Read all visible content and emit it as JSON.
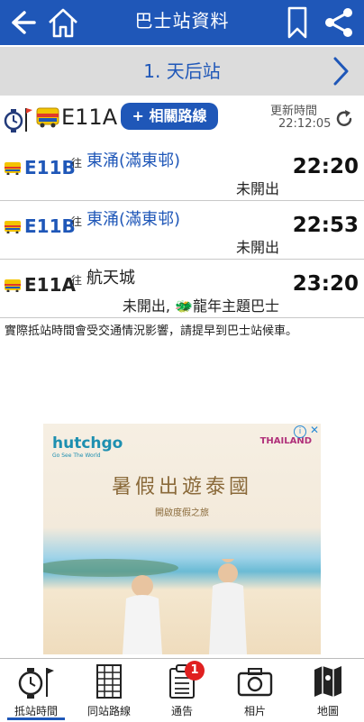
{
  "header": {
    "title": "巴士站資料"
  },
  "stop": {
    "name": "1. 天后站"
  },
  "route": {
    "number": "E11A",
    "related_button": "+ 相關路線",
    "updated_label": "更新時間",
    "updated_time": "22:12:05"
  },
  "etas": [
    {
      "route": "E11B",
      "direction": "往",
      "destination": "東涌(滿東邨)",
      "status": "未開出",
      "time": "22:20",
      "route_color": "#1f57b8",
      "dest_color": "#1f57b8"
    },
    {
      "route": "E11B",
      "direction": "往",
      "destination": "東涌(滿東邨)",
      "status": "未開出",
      "time": "22:53",
      "route_color": "#1f57b8",
      "dest_color": "#1f57b8"
    },
    {
      "route": "E11A",
      "direction": "往",
      "destination": "航天城",
      "status": "未開出, 🐲龍年主題巴士",
      "time": "23:20",
      "route_color": "#111111",
      "dest_color": "#111111"
    }
  ],
  "notice": "實際抵站時間會受交通情況影響，請提早到巴士站候車。",
  "ad": {
    "brand": "hutchgo",
    "brand_tagline": "Go See The World",
    "partner": "THAILAND",
    "headline": "暑假出遊泰國",
    "subline": "開啟度假之旅",
    "info": "i",
    "close": "✕"
  },
  "tabs": [
    {
      "label": "抵站時間",
      "icon": "clock-icon",
      "active": true
    },
    {
      "label": "同站路線",
      "icon": "timetable-icon",
      "active": false
    },
    {
      "label": "通告",
      "icon": "notice-icon",
      "active": false,
      "badge": "1"
    },
    {
      "label": "相片",
      "icon": "camera-icon",
      "active": false
    },
    {
      "label": "地圖",
      "icon": "map-icon",
      "active": false
    }
  ],
  "colors": {
    "primary": "#1f57b8",
    "stop_bar": "#dcdcdc",
    "badge": "#e02020"
  }
}
